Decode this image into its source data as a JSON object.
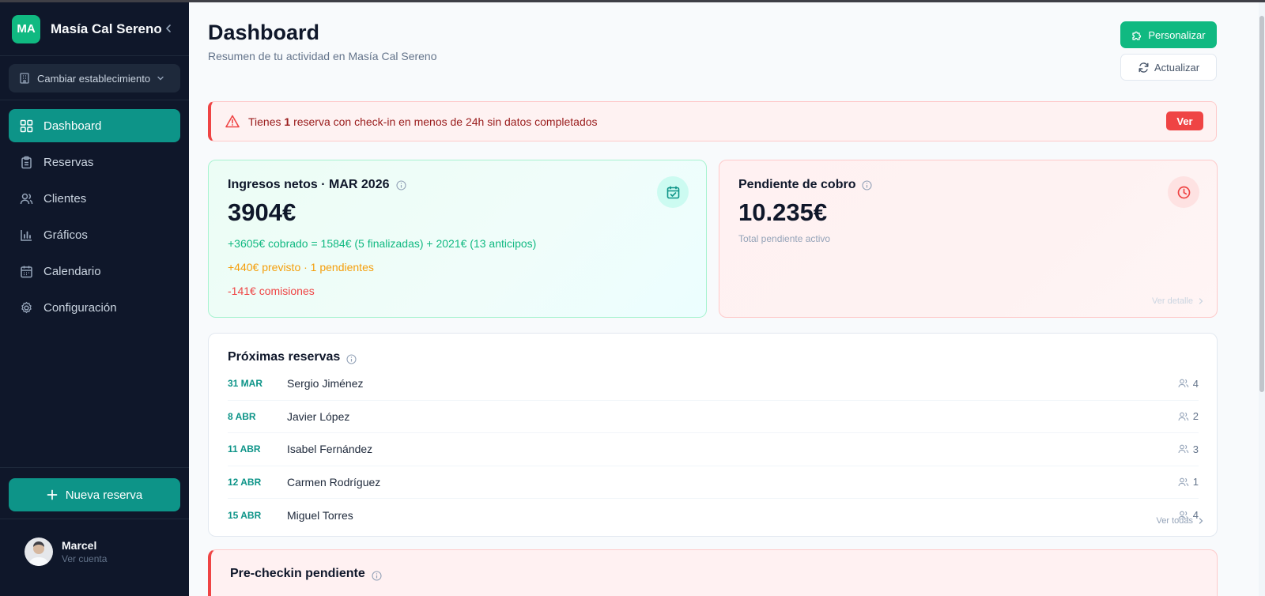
{
  "brand": {
    "initials": "MA",
    "name": "Masía Cal Sereno"
  },
  "switcher": {
    "label": "Cambiar establecimiento"
  },
  "nav": [
    {
      "label": "Dashboard",
      "icon": "grid-icon",
      "active": true
    },
    {
      "label": "Reservas",
      "icon": "clipboard-icon"
    },
    {
      "label": "Clientes",
      "icon": "users-icon"
    },
    {
      "label": "Gráficos",
      "icon": "bar-chart-icon"
    },
    {
      "label": "Calendario",
      "icon": "calendar-icon"
    },
    {
      "label": "Configuración",
      "icon": "gear-icon"
    }
  ],
  "sidebar": {
    "new_booking": "Nueva reserva"
  },
  "user": {
    "name": "Marcel",
    "sub": "Ver cuenta"
  },
  "header": {
    "title": "Dashboard",
    "subtitle": "Resumen de tu actividad en Masía Cal Sereno",
    "customize": "Personalizar",
    "refresh": "Actualizar"
  },
  "alert": {
    "prefix": "Tienes ",
    "count": "1",
    "suffix": " reserva con check-in en menos de 24h sin datos completados",
    "action": "Ver"
  },
  "income": {
    "title": "Ingresos netos · MAR 2026",
    "value": "3904€",
    "collected": "+3605€ cobrado = 1584€ (5 finalizadas) + 2021€ (13 anticipos)",
    "forecast": "+440€ previsto · 1 pendientes",
    "fees": "-141€ comisiones"
  },
  "pending": {
    "title": "Pendiente de cobro",
    "value": "10.235€",
    "sub": "Total pendiente activo",
    "link": "Ver detalle"
  },
  "upcoming": {
    "title": "Próximas reservas",
    "link": "Ver todas",
    "rows": [
      {
        "date": "31 MAR",
        "name": "Sergio Jiménez",
        "guests": "4"
      },
      {
        "date": "8 ABR",
        "name": "Javier López",
        "guests": "2"
      },
      {
        "date": "11 ABR",
        "name": "Isabel Fernández",
        "guests": "3"
      },
      {
        "date": "12 ABR",
        "name": "Carmen Rodríguez",
        "guests": "1"
      },
      {
        "date": "15 ABR",
        "name": "Miguel Torres",
        "guests": "4"
      }
    ]
  },
  "precheckin": {
    "title": "Pre-checkin pendiente"
  },
  "colors": {
    "accent": "#0d9488",
    "brand": "#10b981",
    "danger": "#ef4444",
    "warning": "#f59e0b",
    "sidebar": "#0f172a"
  }
}
